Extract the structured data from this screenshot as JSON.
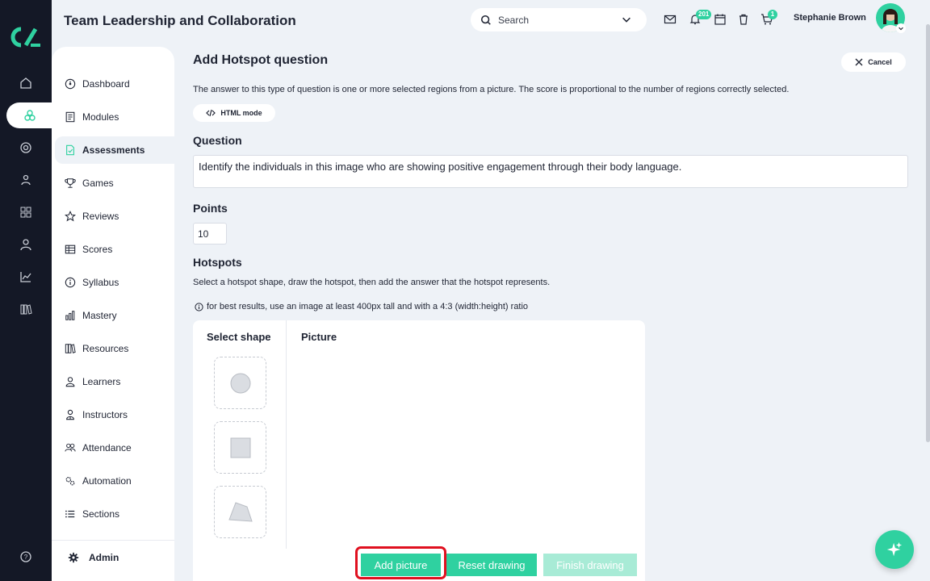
{
  "app": {
    "title": "Team Leadership and Collaboration"
  },
  "header": {
    "search_placeholder": "Search",
    "notifications_count": "201",
    "cart_count": "1",
    "user_name": "Stephanie Brown"
  },
  "sidebar": {
    "items": [
      {
        "label": "Dashboard",
        "icon": "dashboard-icon"
      },
      {
        "label": "Modules",
        "icon": "modules-icon"
      },
      {
        "label": "Assessments",
        "icon": "assessments-icon",
        "active": true
      },
      {
        "label": "Games",
        "icon": "trophy-icon"
      },
      {
        "label": "Reviews",
        "icon": "star-icon"
      },
      {
        "label": "Scores",
        "icon": "table-icon"
      },
      {
        "label": "Syllabus",
        "icon": "info-icon"
      },
      {
        "label": "Mastery",
        "icon": "bar-chart-icon"
      },
      {
        "label": "Resources",
        "icon": "books-icon"
      },
      {
        "label": "Learners",
        "icon": "user-icon"
      },
      {
        "label": "Instructors",
        "icon": "instructor-icon"
      },
      {
        "label": "Attendance",
        "icon": "users-icon"
      },
      {
        "label": "Automation",
        "icon": "gears-icon"
      },
      {
        "label": "Sections",
        "icon": "list-icon"
      }
    ],
    "admin_label": "Admin"
  },
  "main": {
    "title": "Add Hotspot question",
    "cancel_label": "Cancel",
    "description": "The answer to this type of question is one or more selected regions from a picture. The score is proportional to the number of regions correctly selected.",
    "html_mode_label": "HTML mode",
    "question_label": "Question",
    "question_text": "Identify the individuals in this image who are showing positive engagement through their body language.",
    "points_label": "Points",
    "points_value": "10",
    "hotspots_label": "Hotspots",
    "hotspots_desc": "Select a hotspot shape, draw the hotspot, then add the answer that the hotspot represents.",
    "hotspots_info": "for best results, use an image at least 400px tall and with a 4:3 (width:height) ratio",
    "select_shape_label": "Select shape",
    "picture_label": "Picture",
    "add_picture_label": "Add picture",
    "reset_drawing_label": "Reset drawing",
    "finish_drawing_label": "Finish drawing"
  },
  "colors": {
    "accent": "#2fd1a0",
    "rail": "#141826",
    "background": "#eef2f7",
    "highlight": "#e0101f"
  }
}
